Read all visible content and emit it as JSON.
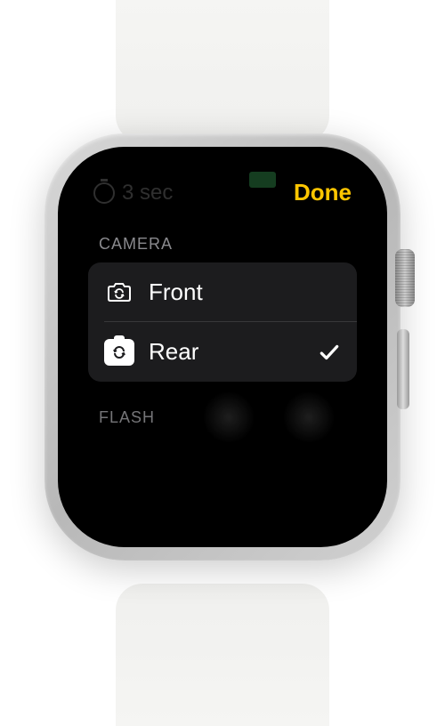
{
  "header": {
    "timer_label": "3 sec",
    "done_label": "Done",
    "accent_color": "#ffc600"
  },
  "sections": {
    "camera": {
      "title": "CAMERA",
      "items": [
        {
          "label": "Front",
          "selected": false
        },
        {
          "label": "Rear",
          "selected": true
        }
      ]
    },
    "flash": {
      "title": "FLASH"
    }
  },
  "highlight_color": "#ff0010"
}
